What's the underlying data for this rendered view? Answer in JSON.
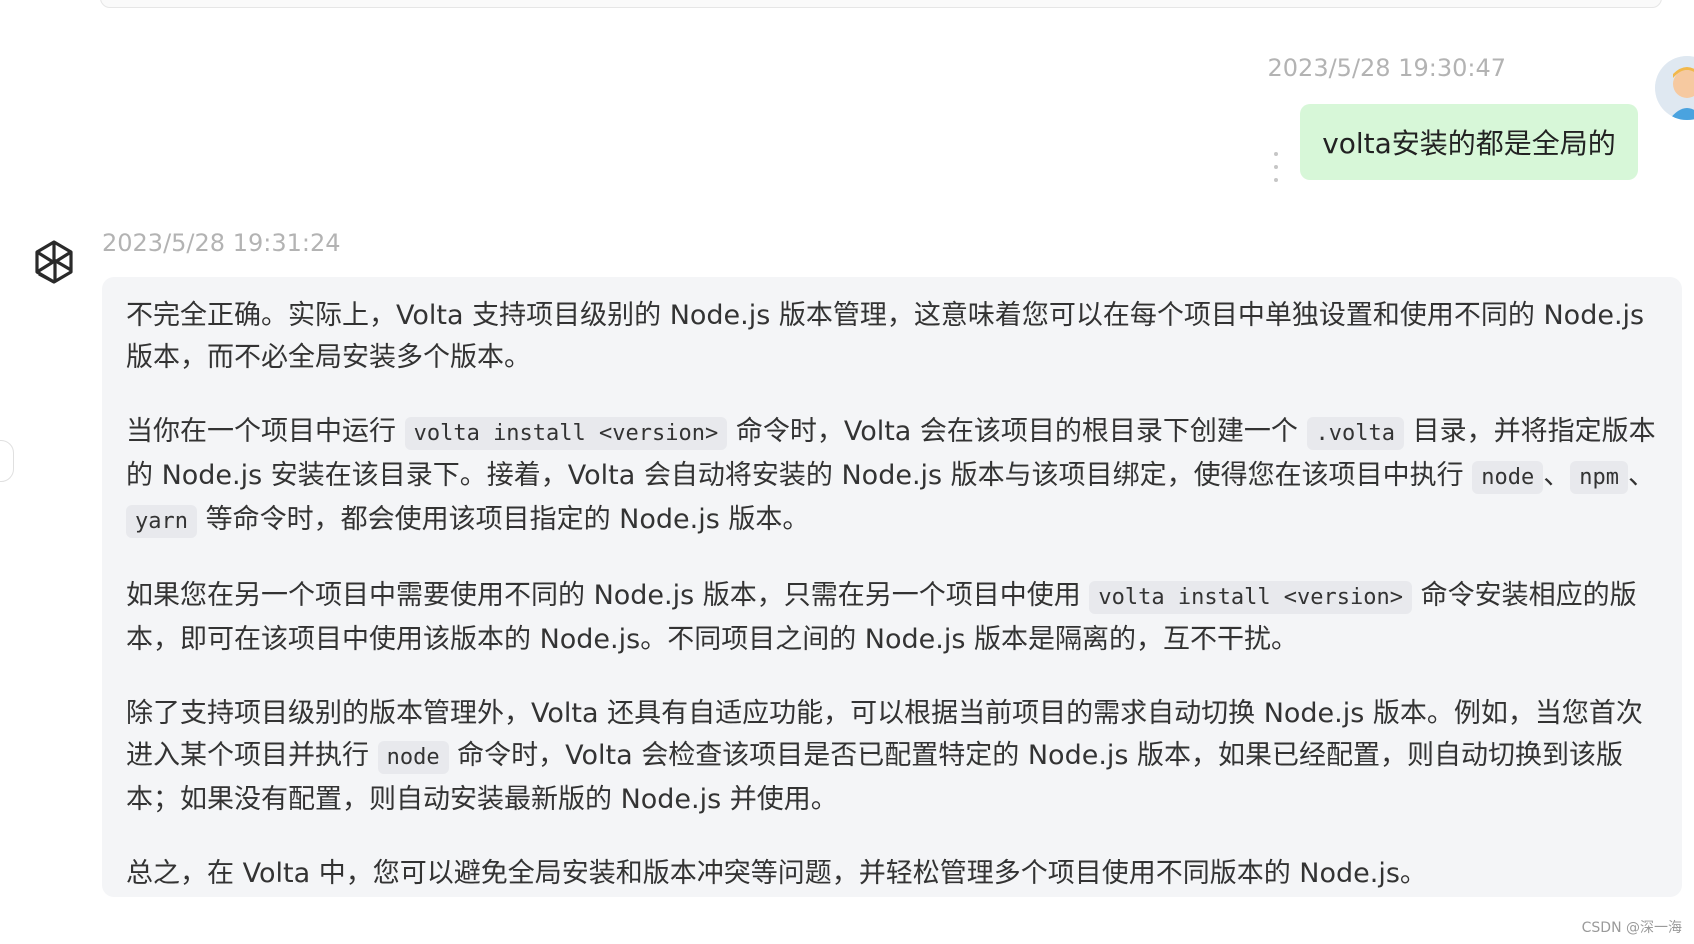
{
  "user_message": {
    "timestamp": "2023/5/28 19:30:47",
    "text": "volta安装的都是全局的",
    "avatar_icon": "user-avatar-icon"
  },
  "assistant_message": {
    "timestamp": "2023/5/28 19:31:24",
    "avatar_icon": "chatgpt-logo-icon",
    "paragraphs": [
      {
        "segments": [
          {
            "type": "text",
            "value": "不完全正确。实际上，Volta 支持项目级别的 Node.js 版本管理，这意味着您可以在每个项目中单独设置和使用不同的 Node.js 版本，而不必全局安装多个版本。"
          }
        ]
      },
      {
        "segments": [
          {
            "type": "text",
            "value": "当你在一个项目中运行 "
          },
          {
            "type": "code",
            "value": "volta install <version>"
          },
          {
            "type": "text",
            "value": " 命令时，Volta 会在该项目的根目录下创建一个 "
          },
          {
            "type": "code",
            "value": ".volta"
          },
          {
            "type": "text",
            "value": " 目录，并将指定版本的 Node.js 安装在该目录下。接着，Volta 会自动将安装的 Node.js 版本与该项目绑定，使得您在该项目中执行 "
          },
          {
            "type": "code",
            "value": "node"
          },
          {
            "type": "text",
            "value": "、"
          },
          {
            "type": "code",
            "value": "npm"
          },
          {
            "type": "text",
            "value": "、"
          },
          {
            "type": "code",
            "value": "yarn"
          },
          {
            "type": "text",
            "value": " 等命令时，都会使用该项目指定的 Node.js 版本。"
          }
        ]
      },
      {
        "segments": [
          {
            "type": "text",
            "value": "如果您在另一个项目中需要使用不同的 Node.js 版本，只需在另一个项目中使用 "
          },
          {
            "type": "code",
            "value": "volta install <version>"
          },
          {
            "type": "text",
            "value": " 命令安装相应的版本，即可在该项目中使用该版本的 Node.js。不同项目之间的 Node.js 版本是隔离的，互不干扰。"
          }
        ]
      },
      {
        "segments": [
          {
            "type": "text",
            "value": "除了支持项目级别的版本管理外，Volta 还具有自适应功能，可以根据当前项目的需求自动切换 Node.js 版本。例如，当您首次进入某个项目并执行 "
          },
          {
            "type": "code",
            "value": "node"
          },
          {
            "type": "text",
            "value": " 命令时，Volta 会检查该项目是否已配置特定的 Node.js 版本，如果已经配置，则自动切换到该版本；如果没有配置，则自动安装最新版的 Node.js 并使用。"
          }
        ]
      },
      {
        "segments": [
          {
            "type": "text",
            "value": "总之，在 Volta 中，您可以避免全局安装和版本冲突等问题，并轻松管理多个项目使用不同版本的 Node.js。"
          }
        ]
      }
    ]
  },
  "watermark": "CSDN @深一海",
  "colors": {
    "user_bubble": "#d7f7d8",
    "assistant_bubble": "#f4f5f7",
    "timestamp": "#b3b3b3",
    "code_bg": "#e8e9ed"
  }
}
